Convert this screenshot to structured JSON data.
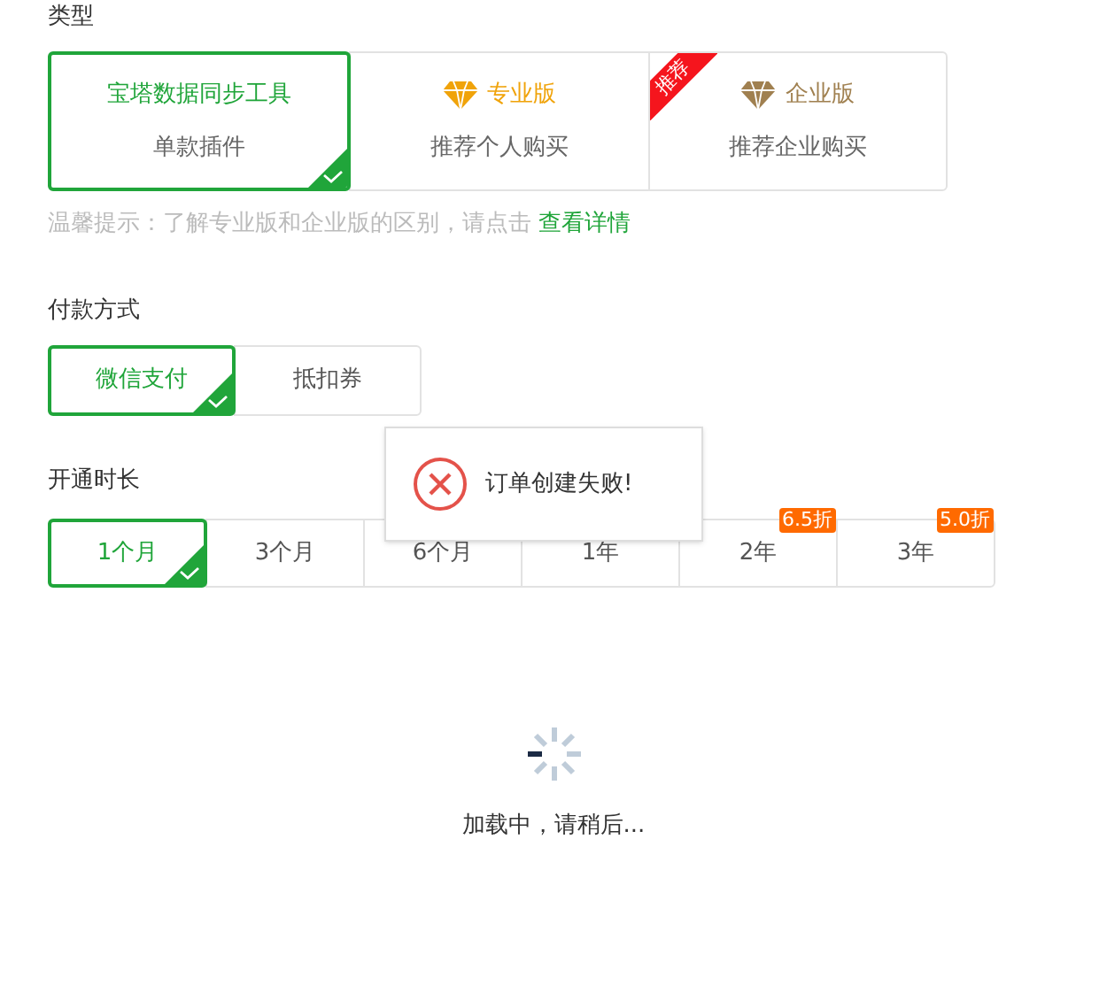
{
  "type_section": {
    "label": "类型",
    "options": [
      {
        "kind": "plain",
        "title": "宝塔数据同步工具",
        "subtitle": "单款插件",
        "selected": true
      },
      {
        "kind": "pro",
        "title": "专业版",
        "subtitle": "推荐个人购买",
        "selected": false
      },
      {
        "kind": "enterprise",
        "title": "企业版",
        "subtitle": "推荐企业购买",
        "selected": false,
        "ribbon": "推荐"
      }
    ],
    "tip": "温馨提示：了解专业版和企业版的区别，请点击",
    "tip_link": "查看详情"
  },
  "payment": {
    "label": "付款方式",
    "options": [
      {
        "label": "微信支付",
        "selected": true
      },
      {
        "label": "抵扣券",
        "selected": false
      }
    ]
  },
  "duration": {
    "label": "开通时长",
    "options": [
      {
        "label": "1个月",
        "selected": true
      },
      {
        "label": "3个月",
        "selected": false
      },
      {
        "label": "6个月",
        "selected": false
      },
      {
        "label": "1年",
        "selected": false
      },
      {
        "label": "2年",
        "selected": false,
        "badge": "6.5折"
      },
      {
        "label": "3年",
        "selected": false,
        "badge": "5.0折"
      }
    ]
  },
  "toast": {
    "message": "订单创建失败!"
  },
  "loading": {
    "text": "加载中，请稍后..."
  }
}
